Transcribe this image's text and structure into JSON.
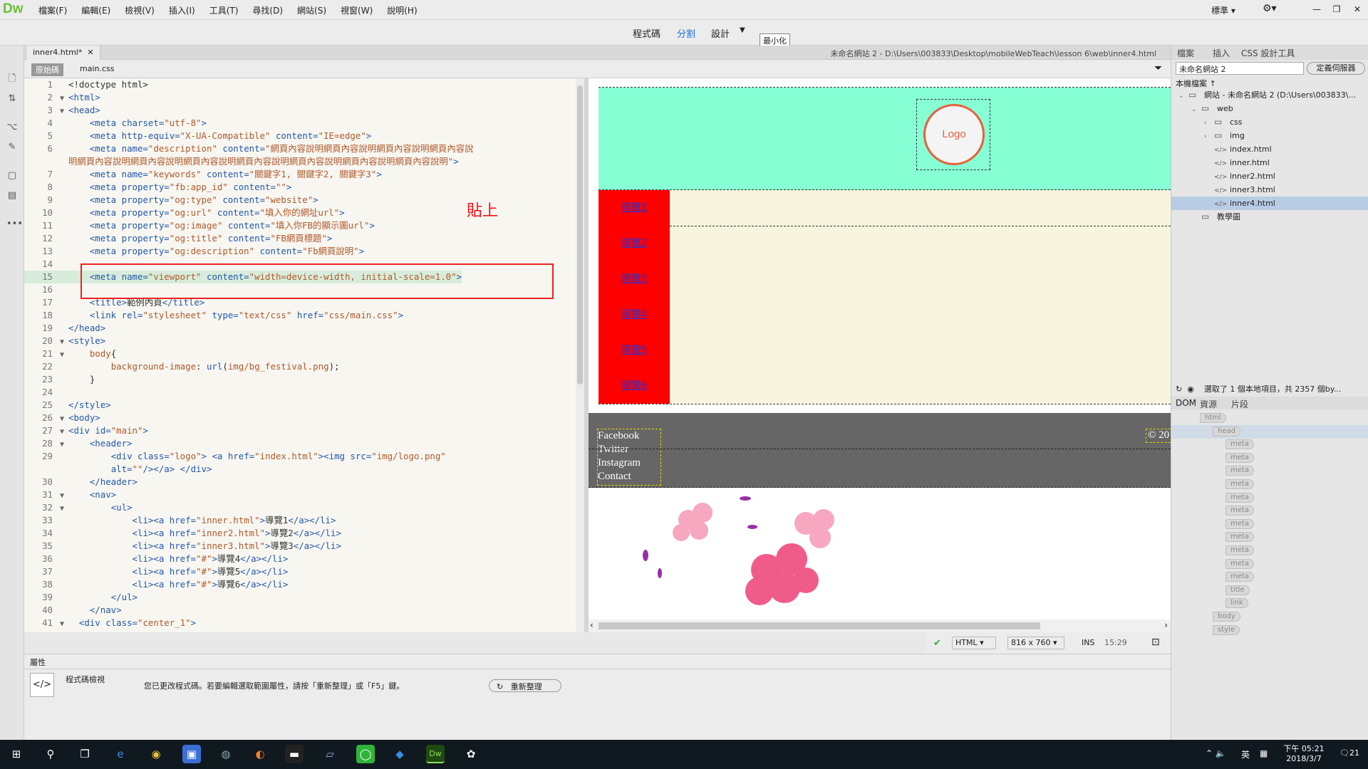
{
  "app": {
    "logo": "Dw",
    "menus": [
      "檔案(F)",
      "編輯(E)",
      "檢視(V)",
      "插入(I)",
      "工具(T)",
      "尋找(D)",
      "網站(S)",
      "視窗(W)",
      "說明(H)"
    ],
    "workspace": "標準",
    "window_controls": [
      "—",
      "❐",
      "✕"
    ]
  },
  "viewbar": {
    "code": "程式碼",
    "split": "分割",
    "design": "設計",
    "tooltip": "最小化"
  },
  "doc": {
    "tab": "inner4.html*",
    "path": "未命名網站 2 - D:\\Users\\003833\\Desktop\\mobileWebTeach\\lesson 6\\web\\inner4.html",
    "source": "原始碼",
    "css": "main.css"
  },
  "code_lines": [
    {
      "n": "1",
      "f": "",
      "segs": [
        [
          "tx",
          "<!doctype html>"
        ]
      ]
    },
    {
      "n": "2",
      "f": "▼",
      "segs": [
        [
          "tg",
          "<html>"
        ]
      ]
    },
    {
      "n": "3",
      "f": "▼",
      "segs": [
        [
          "tg",
          "<head>"
        ]
      ]
    },
    {
      "n": "4",
      "f": "",
      "segs": [
        [
          "tx",
          "    "
        ],
        [
          "tg",
          "<meta "
        ],
        [
          "at",
          "charset="
        ],
        [
          "vl",
          "\"utf-8\""
        ],
        [
          "tg",
          ">"
        ]
      ]
    },
    {
      "n": "5",
      "f": "",
      "segs": [
        [
          "tx",
          "    "
        ],
        [
          "tg",
          "<meta "
        ],
        [
          "at",
          "http-equiv="
        ],
        [
          "vl",
          "\"X-UA-Compatible\""
        ],
        [
          "at",
          " content="
        ],
        [
          "vl",
          "\"IE=edge\""
        ],
        [
          "tg",
          ">"
        ]
      ]
    },
    {
      "n": "6",
      "f": "",
      "segs": [
        [
          "tx",
          "    "
        ],
        [
          "tg",
          "<meta "
        ],
        [
          "at",
          "name="
        ],
        [
          "vl",
          "\"description\""
        ],
        [
          "at",
          " content="
        ],
        [
          "vl",
          "\"網頁內容說明網頁內容說明網頁內容說明網頁內容說"
        ]
      ]
    },
    {
      "n": "",
      "f": "",
      "segs": [
        [
          "vl",
          "明網頁內容說明網頁內容說明網頁內容說明網頁內容說明網頁內容說明網頁內容說明網頁內容說明\""
        ],
        [
          "tg",
          ">"
        ]
      ]
    },
    {
      "n": "7",
      "f": "",
      "segs": [
        [
          "tx",
          "    "
        ],
        [
          "tg",
          "<meta "
        ],
        [
          "at",
          "name="
        ],
        [
          "vl",
          "\"keywords\""
        ],
        [
          "at",
          " content="
        ],
        [
          "vl",
          "\"關鍵字1, 關鍵字2, 關鍵字3\""
        ],
        [
          "tg",
          ">"
        ]
      ]
    },
    {
      "n": "8",
      "f": "",
      "segs": [
        [
          "tx",
          "    "
        ],
        [
          "tg",
          "<meta "
        ],
        [
          "at",
          "property="
        ],
        [
          "vl",
          "\"fb:app_id\""
        ],
        [
          "at",
          " content="
        ],
        [
          "vl",
          "\"\""
        ],
        [
          "tg",
          ">"
        ]
      ]
    },
    {
      "n": "9",
      "f": "",
      "segs": [
        [
          "tx",
          "    "
        ],
        [
          "tg",
          "<meta "
        ],
        [
          "at",
          "property="
        ],
        [
          "vl",
          "\"og:type\""
        ],
        [
          "at",
          " content="
        ],
        [
          "vl",
          "\"website\""
        ],
        [
          "tg",
          ">"
        ]
      ]
    },
    {
      "n": "10",
      "f": "",
      "segs": [
        [
          "tx",
          "    "
        ],
        [
          "tg",
          "<meta "
        ],
        [
          "at",
          "property="
        ],
        [
          "vl",
          "\"og:url\""
        ],
        [
          "at",
          " content="
        ],
        [
          "vl",
          "\"填入你的網址url\""
        ],
        [
          "tg",
          ">"
        ]
      ]
    },
    {
      "n": "11",
      "f": "",
      "segs": [
        [
          "tx",
          "    "
        ],
        [
          "tg",
          "<meta "
        ],
        [
          "at",
          "property="
        ],
        [
          "vl",
          "\"og:image\""
        ],
        [
          "at",
          " content="
        ],
        [
          "vl",
          "\"填入你FB的顯示圖url\""
        ],
        [
          "tg",
          ">"
        ]
      ]
    },
    {
      "n": "12",
      "f": "",
      "segs": [
        [
          "tx",
          "    "
        ],
        [
          "tg",
          "<meta "
        ],
        [
          "at",
          "property="
        ],
        [
          "vl",
          "\"og:title\""
        ],
        [
          "at",
          " content="
        ],
        [
          "vl",
          "\"FB網頁標題\""
        ],
        [
          "tg",
          ">"
        ]
      ]
    },
    {
      "n": "13",
      "f": "",
      "segs": [
        [
          "tx",
          "    "
        ],
        [
          "tg",
          "<meta "
        ],
        [
          "at",
          "property="
        ],
        [
          "vl",
          "\"og:description\""
        ],
        [
          "at",
          " content="
        ],
        [
          "vl",
          "\"Fb網頁說明\""
        ],
        [
          "tg",
          ">"
        ]
      ]
    },
    {
      "n": "14",
      "f": "",
      "segs": []
    },
    {
      "n": "15",
      "f": "",
      "segs": [
        [
          "tx",
          "    "
        ],
        [
          "tg",
          "<meta "
        ],
        [
          "at",
          "name="
        ],
        [
          "vl",
          "\"viewport\""
        ],
        [
          "at",
          " content="
        ],
        [
          "vl",
          "\"width=device-width, initial-scale=1.0\""
        ],
        [
          "tg",
          ">"
        ]
      ]
    },
    {
      "n": "16",
      "f": "",
      "segs": []
    },
    {
      "n": "17",
      "f": "",
      "segs": [
        [
          "tx",
          "    "
        ],
        [
          "tg",
          "<title>"
        ],
        [
          "tx",
          "範例內頁"
        ],
        [
          "tg",
          "</title>"
        ]
      ]
    },
    {
      "n": "18",
      "f": "",
      "segs": [
        [
          "tx",
          "    "
        ],
        [
          "tg",
          "<link "
        ],
        [
          "at",
          "rel="
        ],
        [
          "vl",
          "\"stylesheet\""
        ],
        [
          "at",
          " type="
        ],
        [
          "vl",
          "\"text/css\""
        ],
        [
          "at",
          " href="
        ],
        [
          "vl",
          "\"css/main.css\""
        ],
        [
          "tg",
          ">"
        ]
      ]
    },
    {
      "n": "19",
      "f": "",
      "segs": [
        [
          "tg",
          "</head>"
        ]
      ]
    },
    {
      "n": "20",
      "f": "▼",
      "segs": [
        [
          "tg",
          "<style>"
        ]
      ]
    },
    {
      "n": "21",
      "f": "▼",
      "segs": [
        [
          "tx",
          "    "
        ],
        [
          "vl",
          "body"
        ],
        [
          "tx",
          "{"
        ]
      ]
    },
    {
      "n": "22",
      "f": "",
      "segs": [
        [
          "tx",
          "        "
        ],
        [
          "vl",
          "background-image"
        ],
        [
          "tx",
          ": "
        ],
        [
          "at",
          "url"
        ],
        [
          "tx",
          "("
        ],
        [
          "vl",
          "img/bg_festival.png"
        ],
        [
          "tx",
          ");"
        ]
      ]
    },
    {
      "n": "23",
      "f": "",
      "segs": [
        [
          "tx",
          "    }"
        ]
      ]
    },
    {
      "n": "24",
      "f": "",
      "segs": []
    },
    {
      "n": "25",
      "f": "",
      "segs": [
        [
          "tg",
          "</style>"
        ]
      ]
    },
    {
      "n": "26",
      "f": "▼",
      "segs": [
        [
          "tg",
          "<body>"
        ]
      ]
    },
    {
      "n": "27",
      "f": "▼",
      "segs": [
        [
          "tg",
          "<div "
        ],
        [
          "at",
          "id="
        ],
        [
          "vl",
          "\"main\""
        ],
        [
          "tg",
          ">"
        ]
      ]
    },
    {
      "n": "28",
      "f": "▼",
      "segs": [
        [
          "tx",
          "    "
        ],
        [
          "tg",
          "<header>"
        ]
      ]
    },
    {
      "n": "29",
      "f": "",
      "segs": [
        [
          "tx",
          "        "
        ],
        [
          "tg",
          "<div "
        ],
        [
          "at",
          "class="
        ],
        [
          "vl",
          "\"logo\""
        ],
        [
          "tg",
          "> <a "
        ],
        [
          "at",
          "href="
        ],
        [
          "vl",
          "\"index.html\""
        ],
        [
          "tg",
          "><img "
        ],
        [
          "at",
          "src="
        ],
        [
          "vl",
          "\"img/logo.png\""
        ]
      ]
    },
    {
      "n": "",
      "f": "",
      "segs": [
        [
          "tx",
          "        "
        ],
        [
          "at",
          "alt="
        ],
        [
          "vl",
          "\"\""
        ],
        [
          "tg",
          "/></a> </div>"
        ]
      ]
    },
    {
      "n": "30",
      "f": "",
      "segs": [
        [
          "tx",
          "    "
        ],
        [
          "tg",
          "</header>"
        ]
      ]
    },
    {
      "n": "31",
      "f": "▼",
      "segs": [
        [
          "tx",
          "    "
        ],
        [
          "tg",
          "<nav>"
        ]
      ]
    },
    {
      "n": "32",
      "f": "▼",
      "segs": [
        [
          "tx",
          "        "
        ],
        [
          "tg",
          "<ul>"
        ]
      ]
    },
    {
      "n": "33",
      "f": "",
      "segs": [
        [
          "tx",
          "            "
        ],
        [
          "tg",
          "<li><a "
        ],
        [
          "at",
          "href="
        ],
        [
          "vl",
          "\"inner.html\""
        ],
        [
          "tg",
          ">"
        ],
        [
          "tx",
          "導覽1"
        ],
        [
          "tg",
          "</a></li>"
        ]
      ]
    },
    {
      "n": "34",
      "f": "",
      "segs": [
        [
          "tx",
          "            "
        ],
        [
          "tg",
          "<li><a "
        ],
        [
          "at",
          "href="
        ],
        [
          "vl",
          "\"inner2.html\""
        ],
        [
          "tg",
          ">"
        ],
        [
          "tx",
          "導覽2"
        ],
        [
          "tg",
          "</a></li>"
        ]
      ]
    },
    {
      "n": "35",
      "f": "",
      "segs": [
        [
          "tx",
          "            "
        ],
        [
          "tg",
          "<li><a "
        ],
        [
          "at",
          "href="
        ],
        [
          "vl",
          "\"inner3.html\""
        ],
        [
          "tg",
          ">"
        ],
        [
          "tx",
          "導覽3"
        ],
        [
          "tg",
          "</a></li>"
        ]
      ]
    },
    {
      "n": "36",
      "f": "",
      "segs": [
        [
          "tx",
          "            "
        ],
        [
          "tg",
          "<li><a "
        ],
        [
          "at",
          "href="
        ],
        [
          "vl",
          "\"#\""
        ],
        [
          "tg",
          ">"
        ],
        [
          "tx",
          "導覽4"
        ],
        [
          "tg",
          "</a></li>"
        ]
      ]
    },
    {
      "n": "37",
      "f": "",
      "segs": [
        [
          "tx",
          "            "
        ],
        [
          "tg",
          "<li><a "
        ],
        [
          "at",
          "href="
        ],
        [
          "vl",
          "\"#\""
        ],
        [
          "tg",
          ">"
        ],
        [
          "tx",
          "導覽5"
        ],
        [
          "tg",
          "</a></li>"
        ]
      ]
    },
    {
      "n": "38",
      "f": "",
      "segs": [
        [
          "tx",
          "            "
        ],
        [
          "tg",
          "<li><a "
        ],
        [
          "at",
          "href="
        ],
        [
          "vl",
          "\"#\""
        ],
        [
          "tg",
          ">"
        ],
        [
          "tx",
          "導覽6"
        ],
        [
          "tg",
          "</a></li>"
        ]
      ]
    },
    {
      "n": "39",
      "f": "",
      "segs": [
        [
          "tx",
          "        "
        ],
        [
          "tg",
          "</ul>"
        ]
      ]
    },
    {
      "n": "40",
      "f": "",
      "segs": [
        [
          "tx",
          "    "
        ],
        [
          "tg",
          "</nav>"
        ]
      ]
    },
    {
      "n": "41",
      "f": "▼",
      "segs": [
        [
          "tx",
          "  "
        ],
        [
          "tg",
          "<div "
        ],
        [
          "at",
          "class="
        ],
        [
          "vl",
          "\"center_1\""
        ],
        [
          "tg",
          ">"
        ]
      ]
    }
  ],
  "annotation": "貼上",
  "design": {
    "logo": "Logo",
    "nav": [
      "導覽1",
      "導覽2",
      "導覽3",
      "導覽4",
      "導覽5",
      "導覽6"
    ],
    "social": [
      "Facebook",
      "Twitter",
      "Instagram",
      "Contact"
    ],
    "copyright": "© 20",
    "colors": {
      "header": "#86ffd4",
      "nav": "#ff0000",
      "content": "#f7f5dd",
      "footer": "#666666",
      "logo_ring": "#e8603c"
    }
  },
  "status": {
    "lang": "HTML",
    "size": "816 x 760",
    "mode": "INS",
    "pos": "15:29"
  },
  "props": {
    "title": "屬性",
    "label": "程式碼檢視",
    "message": "您已更改程式碼。若要編輯選取範圍屬性，請按「重新整理」或「F5」鍵。",
    "refresh": "重新整理"
  },
  "right": {
    "tabs": [
      "檔案",
      "插入",
      "CSS 設計工具"
    ],
    "site": "未命名網站 2",
    "define": "定義伺服器",
    "local": "本機檔案 ↑",
    "tree": [
      {
        "d": 0,
        "t": "網站 - 未命名網站 2 (D:\\Users\\003833\\...",
        "ic": "folder"
      },
      {
        "d": 1,
        "t": "web",
        "ic": "folder"
      },
      {
        "d": 2,
        "t": "css",
        "ic": "folder"
      },
      {
        "d": 2,
        "t": "img",
        "ic": "folder"
      },
      {
        "d": 2,
        "t": "index.html",
        "ic": "code"
      },
      {
        "d": 2,
        "t": "inner.html",
        "ic": "code"
      },
      {
        "d": 2,
        "t": "inner2.html",
        "ic": "code"
      },
      {
        "d": 2,
        "t": "inner3.html",
        "ic": "code"
      },
      {
        "d": 2,
        "t": "inner4.html",
        "ic": "code",
        "sel": true
      },
      {
        "d": 1,
        "t": "教學圖",
        "ic": "folder"
      }
    ],
    "selinfo": "選取了 1 個本地項目，共 2357 個by...",
    "domtabs": [
      "DOM",
      "資源",
      "片段"
    ],
    "dom": [
      {
        "d": 0,
        "t": "html"
      },
      {
        "d": 1,
        "t": "head",
        "sel": true
      },
      {
        "d": 2,
        "t": "meta"
      },
      {
        "d": 2,
        "t": "meta"
      },
      {
        "d": 2,
        "t": "meta"
      },
      {
        "d": 2,
        "t": "meta"
      },
      {
        "d": 2,
        "t": "meta"
      },
      {
        "d": 2,
        "t": "meta"
      },
      {
        "d": 2,
        "t": "meta"
      },
      {
        "d": 2,
        "t": "meta"
      },
      {
        "d": 2,
        "t": "meta"
      },
      {
        "d": 2,
        "t": "meta"
      },
      {
        "d": 2,
        "t": "meta"
      },
      {
        "d": 2,
        "t": "title"
      },
      {
        "d": 2,
        "t": "link"
      },
      {
        "d": 1,
        "t": "body"
      },
      {
        "d": 1,
        "t": "style"
      }
    ]
  },
  "taskbar": {
    "time": "下午 05:21",
    "date": "2018/3/7",
    "ime": "英",
    "badge": "21"
  }
}
